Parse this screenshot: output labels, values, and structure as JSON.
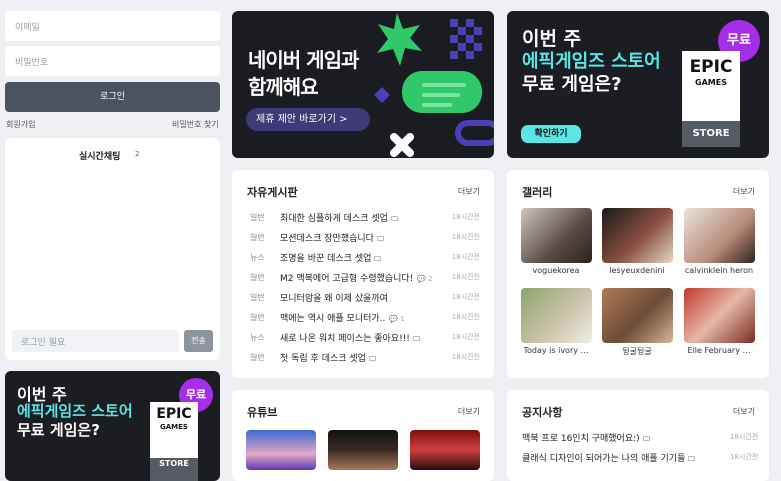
{
  "login": {
    "email_placeholder": "이메일",
    "password_placeholder": "비밀번호",
    "login_button": "로그인",
    "signup_link": "회원가입",
    "find_password_link": "비밀번호 찾기"
  },
  "chat": {
    "title": "실시간채팅",
    "count": "2",
    "input_placeholder": "로그인 필요",
    "send_button": "전송"
  },
  "naver_banner": {
    "line1": "네이버 게임과",
    "line2": "함께해요",
    "cta": "제휴 제안 바로가기 >"
  },
  "epic_banner": {
    "line1": "이번 주",
    "line2": "에픽게임즈 스토어",
    "line3": "무료 게임은?",
    "badge": "무료",
    "logo_top": "EPIC",
    "logo_mid": "GAMES",
    "logo_store": "STORE",
    "cta": "확인하기",
    "colors": {
      "accent": "#58e6e6",
      "badge": "#a52fe8",
      "bg": "#1c1d22"
    }
  },
  "board": {
    "title": "자유게시판",
    "more": "더보기",
    "posts": [
      {
        "category": "일반",
        "title": "최대한 심플하게 데스크 셋업",
        "comments": "",
        "time": "18시간전"
      },
      {
        "category": "일반",
        "title": "모션데스크 장만했습니다",
        "comments": "",
        "time": "18시간전"
      },
      {
        "category": "뉴스",
        "title": "조명을 바꾼 데스크 셋업",
        "comments": "",
        "time": "18시간전"
      },
      {
        "category": "일반",
        "title": "M2 맥북에어 고급형 수령했습니다!",
        "comments": "2",
        "time": "18시간전"
      },
      {
        "category": "일반",
        "title": "모니터암을 왜 이제 샀을까여",
        "comments": "",
        "time": "18시간전"
      },
      {
        "category": "일반",
        "title": "맥에는 역시 애플 모니터가..",
        "comments": "1",
        "time": "18시간전"
      },
      {
        "category": "뉴스",
        "title": "새로 나온 워치 페이스는 좋아요!!!",
        "comments": "",
        "time": "18시간전"
      },
      {
        "category": "일반",
        "title": "첫 독립 후 데스크 셋업",
        "comments": "",
        "time": "18시간전"
      }
    ]
  },
  "gallery": {
    "title": "갤러리",
    "more": "더보기",
    "items": [
      {
        "name": "voguekorea"
      },
      {
        "name": "lesyeuxdenini"
      },
      {
        "name": "calvinklein heron"
      },
      {
        "name": "Today is ivory …"
      },
      {
        "name": "뒹굴뒹굴"
      },
      {
        "name": "Elle February …"
      }
    ]
  },
  "youtube": {
    "title": "유튜브",
    "more": "더보기"
  },
  "notices": {
    "title": "공지사항",
    "more": "더보기",
    "items": [
      {
        "title": "맥북 프로 16인치 구매했어요:)",
        "time": "18시간전"
      },
      {
        "title": "클래식 디자인이 되어가는 나의 애플 기기들",
        "time": "18시간전"
      }
    ]
  }
}
